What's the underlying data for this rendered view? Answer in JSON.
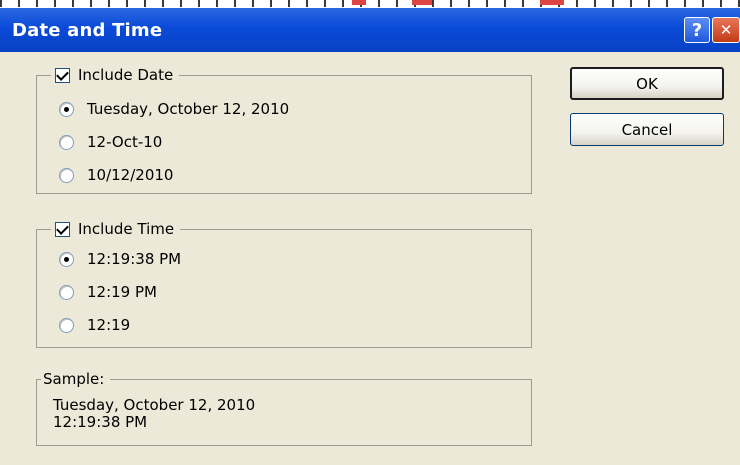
{
  "window": {
    "title": "Date and Time",
    "help_glyph": "?",
    "close_glyph": "✕"
  },
  "date_group": {
    "checkbox_label": "Include Date",
    "checked": true,
    "options": [
      "Tuesday, October 12, 2010",
      "12-Oct-10",
      "10/12/2010"
    ],
    "selected_index": 0
  },
  "time_group": {
    "checkbox_label": "Include Time",
    "checked": true,
    "options": [
      "12:19:38 PM",
      "12:19 PM",
      "12:19"
    ],
    "selected_index": 0
  },
  "sample": {
    "label": "Sample:",
    "line1": "Tuesday, October 12, 2010",
    "line2": "12:19:38 PM"
  },
  "buttons": {
    "ok_label": "OK",
    "cancel_label": "Cancel"
  },
  "colors": {
    "titlebar": "#0a4ad8",
    "dialog_bg": "#ece9d8",
    "close_button": "#c43a16"
  }
}
